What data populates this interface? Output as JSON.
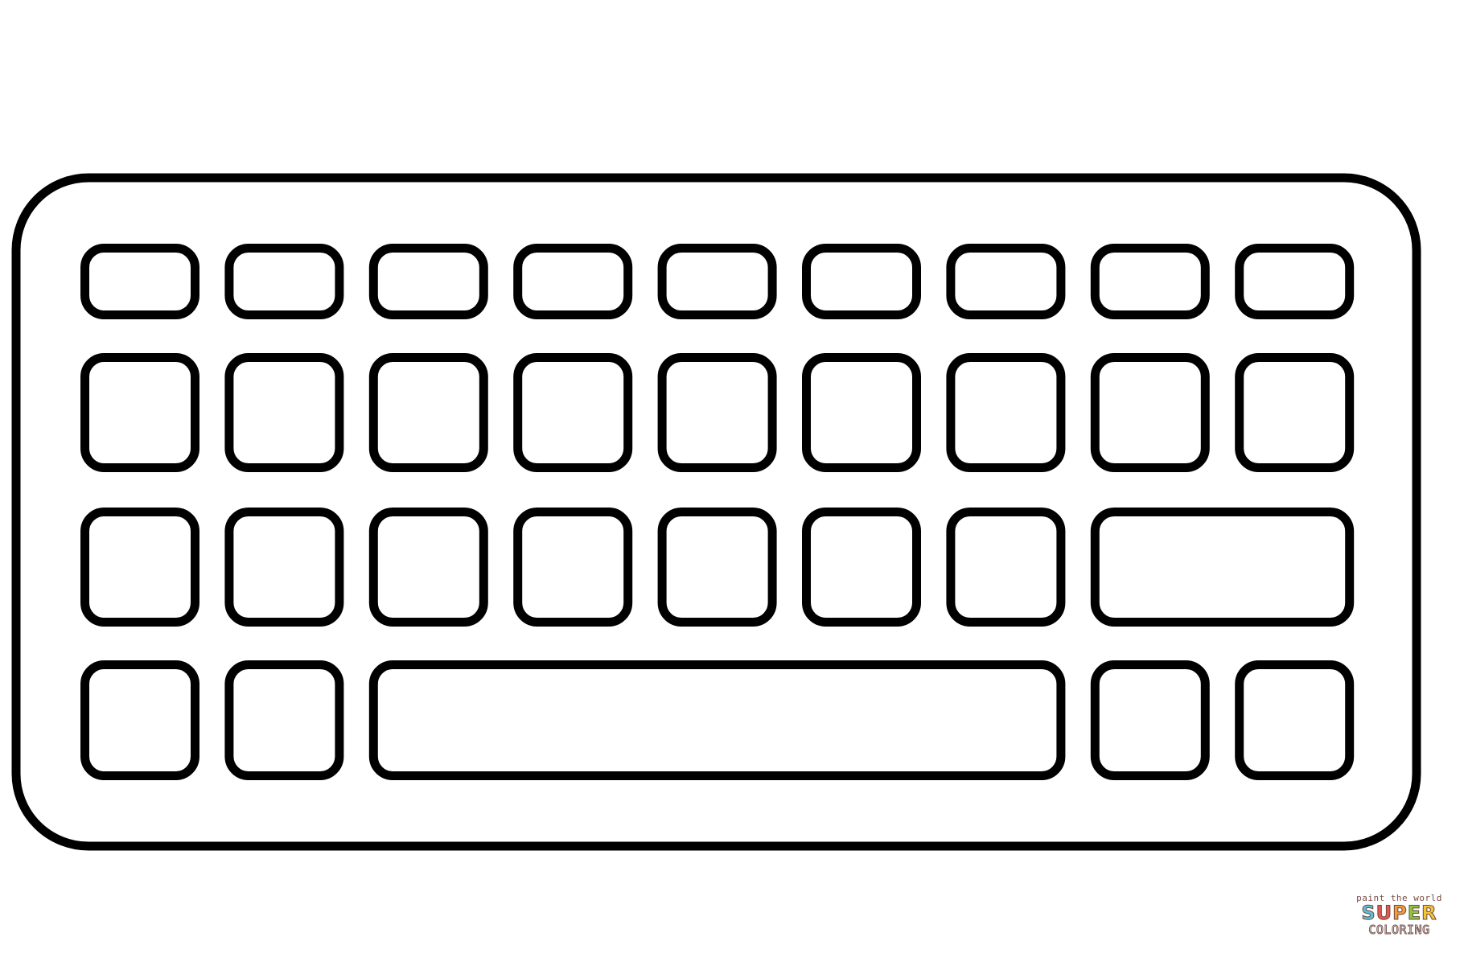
{
  "illustration": {
    "title": "Keyboard coloring page",
    "stroke_color": "#000000",
    "fill_color": "#ffffff",
    "rows": [
      {
        "name": "row-1",
        "keys": [
          1,
          1,
          1,
          1,
          1,
          1,
          1,
          1,
          1
        ],
        "short": true
      },
      {
        "name": "row-2",
        "keys": [
          1,
          1,
          1,
          1,
          1,
          1,
          1,
          1,
          1
        ],
        "short": false
      },
      {
        "name": "row-3",
        "keys": [
          1,
          1,
          1,
          1,
          1,
          1,
          1,
          2
        ],
        "short": false
      },
      {
        "name": "row-4",
        "keys": [
          1,
          1,
          5,
          1,
          1
        ],
        "short": false
      }
    ]
  },
  "watermark": {
    "tagline": "paint the world",
    "word1_letters": [
      {
        "ch": "S",
        "color": "#5bc3d6"
      },
      {
        "ch": "U",
        "color": "#e9574f"
      },
      {
        "ch": "P",
        "color": "#f39a3c"
      },
      {
        "ch": "E",
        "color": "#8cc63f"
      },
      {
        "ch": "R",
        "color": "#f6c532"
      }
    ],
    "word2": "COLORING",
    "accent_color": "#d9342b"
  }
}
